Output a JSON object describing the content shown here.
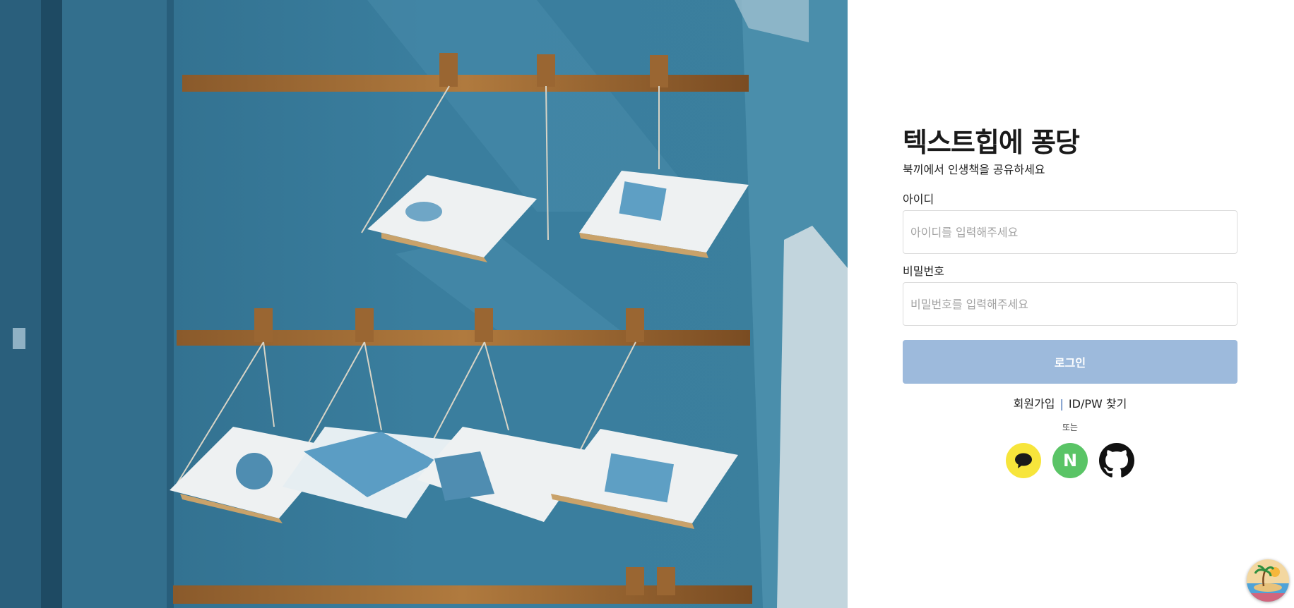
{
  "login": {
    "title": "텍스트힙에 퐁당",
    "subtitle": "북끼에서 인생책을 공유하세요",
    "id_label": "아이디",
    "id_placeholder": "아이디를 입력해주세요",
    "id_value": "",
    "pw_label": "비밀번호",
    "pw_placeholder": "비밀번호를 입력해주세요",
    "pw_value": "",
    "login_button": "로그인",
    "signup_link": "회원가입",
    "separator": "|",
    "find_link": "ID/PW 찾기",
    "or_text": "또는"
  },
  "social": {
    "kakao_icon": "speech-bubble-icon",
    "naver_letter": "N",
    "github_icon": "github-icon"
  },
  "colors": {
    "accent": "#9dbadc",
    "separator": "#3f6db3",
    "kakao": "#f7e53b",
    "naver": "#5ac466",
    "hero": "#3a7a99"
  }
}
